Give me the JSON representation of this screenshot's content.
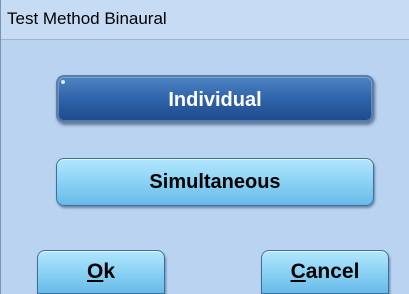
{
  "window": {
    "title": "Test Method Binaural"
  },
  "buttons": {
    "individual": {
      "label": "Individual",
      "selected": true
    },
    "simultaneous": {
      "label": "Simultaneous",
      "selected": false
    },
    "ok": {
      "mnemonic": "O",
      "rest": "k"
    },
    "cancel": {
      "mnemonic": "C",
      "rest": "ancel"
    }
  },
  "colors": {
    "dialog_background": "#b9d3f0",
    "button_light": "#8fd4f5",
    "button_selected": "#2f63a9"
  }
}
